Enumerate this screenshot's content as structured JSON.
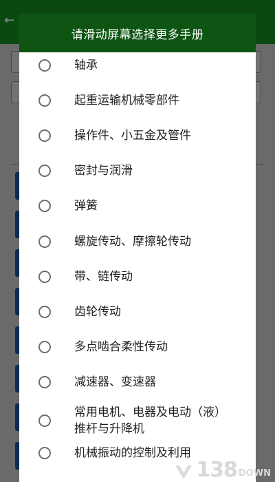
{
  "dialog": {
    "title": "请滑动屏幕选择更多手册",
    "items": [
      {
        "label": "轴承",
        "selected": false
      },
      {
        "label": "起重运输机械零部件",
        "selected": false
      },
      {
        "label": "操作件、小五金及管件",
        "selected": false
      },
      {
        "label": "密封与润滑",
        "selected": false
      },
      {
        "label": "弹簧",
        "selected": false
      },
      {
        "label": "螺旋传动、摩擦轮传动",
        "selected": false
      },
      {
        "label": "带、链传动",
        "selected": false
      },
      {
        "label": "齿轮传动",
        "selected": false
      },
      {
        "label": "多点啮合柔性传动",
        "selected": false
      },
      {
        "label": "减速器、变速器",
        "selected": false
      },
      {
        "label": "常用电机、电器及电动（液）推杆与升降机",
        "selected": false
      },
      {
        "label": "机械振动的控制及利用",
        "selected": false
      }
    ]
  },
  "watermark": {
    "number": "138",
    "text": "DOWN"
  },
  "colors": {
    "header_bg": "#0e5513",
    "radio_border": "#6e6e6e",
    "chip": "#0b2c55"
  }
}
